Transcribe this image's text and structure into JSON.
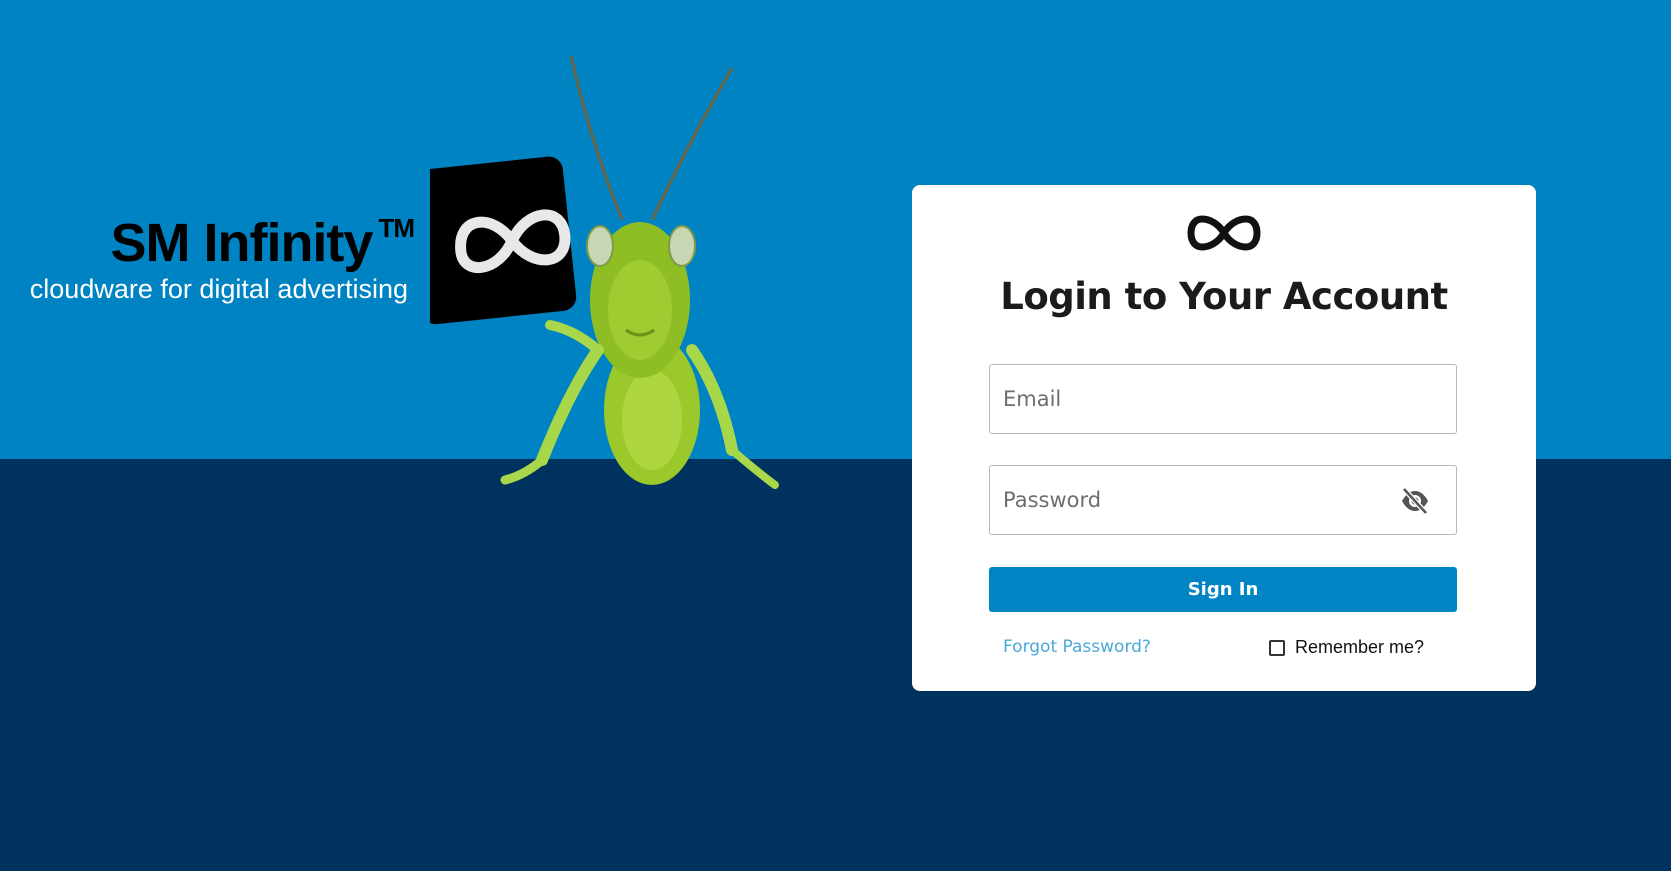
{
  "brand": {
    "name": "SM Infinity",
    "trademark": "TM",
    "tagline": "cloudware for digital advertising"
  },
  "login": {
    "title": "Login to Your Account",
    "email_placeholder": "Email",
    "password_placeholder": "Password",
    "sign_in_label": "Sign In",
    "forgot_password_label": "Forgot Password?",
    "remember_me_label": "Remember me?",
    "remember_me_checked": false
  },
  "icons": {
    "card_logo": "infinity-icon",
    "password_toggle": "eye-slash-icon",
    "mascot": "grasshopper-with-infinity-sign"
  },
  "colors": {
    "top_band": "#0083c3",
    "bottom_band": "#00325f",
    "button": "#0084c4",
    "link": "#4aa8d8"
  }
}
